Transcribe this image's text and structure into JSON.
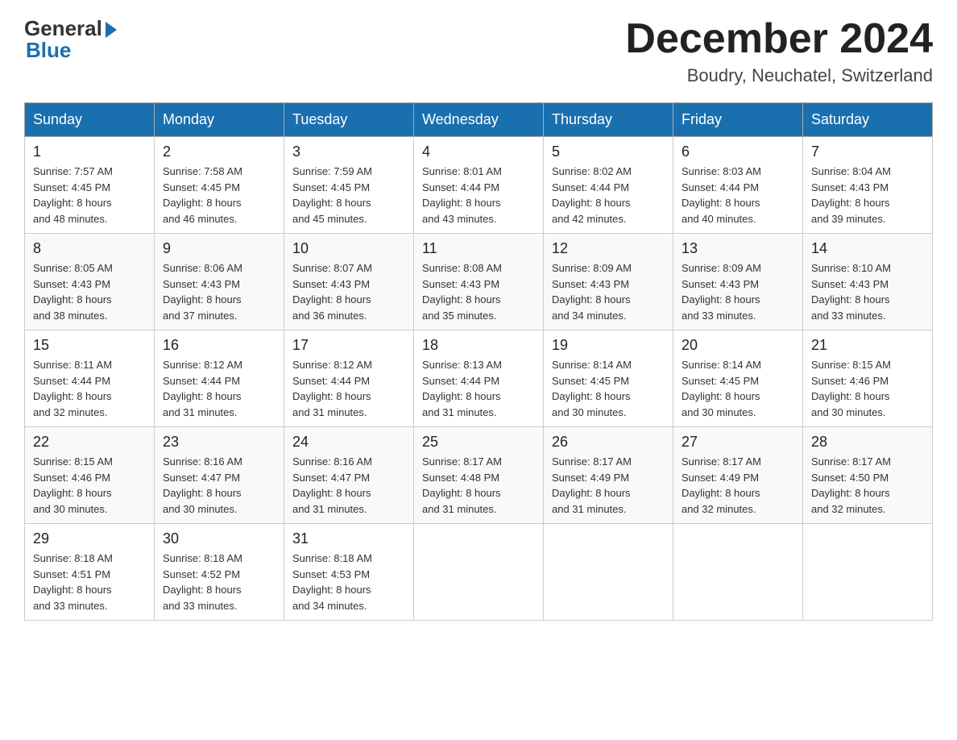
{
  "header": {
    "logo_general": "General",
    "logo_blue": "Blue",
    "month_title": "December 2024",
    "location": "Boudry, Neuchatel, Switzerland"
  },
  "weekdays": [
    "Sunday",
    "Monday",
    "Tuesday",
    "Wednesday",
    "Thursday",
    "Friday",
    "Saturday"
  ],
  "weeks": [
    [
      {
        "day": "1",
        "sunrise": "7:57 AM",
        "sunset": "4:45 PM",
        "daylight": "8 hours and 48 minutes."
      },
      {
        "day": "2",
        "sunrise": "7:58 AM",
        "sunset": "4:45 PM",
        "daylight": "8 hours and 46 minutes."
      },
      {
        "day": "3",
        "sunrise": "7:59 AM",
        "sunset": "4:45 PM",
        "daylight": "8 hours and 45 minutes."
      },
      {
        "day": "4",
        "sunrise": "8:01 AM",
        "sunset": "4:44 PM",
        "daylight": "8 hours and 43 minutes."
      },
      {
        "day": "5",
        "sunrise": "8:02 AM",
        "sunset": "4:44 PM",
        "daylight": "8 hours and 42 minutes."
      },
      {
        "day": "6",
        "sunrise": "8:03 AM",
        "sunset": "4:44 PM",
        "daylight": "8 hours and 40 minutes."
      },
      {
        "day": "7",
        "sunrise": "8:04 AM",
        "sunset": "4:43 PM",
        "daylight": "8 hours and 39 minutes."
      }
    ],
    [
      {
        "day": "8",
        "sunrise": "8:05 AM",
        "sunset": "4:43 PM",
        "daylight": "8 hours and 38 minutes."
      },
      {
        "day": "9",
        "sunrise": "8:06 AM",
        "sunset": "4:43 PM",
        "daylight": "8 hours and 37 minutes."
      },
      {
        "day": "10",
        "sunrise": "8:07 AM",
        "sunset": "4:43 PM",
        "daylight": "8 hours and 36 minutes."
      },
      {
        "day": "11",
        "sunrise": "8:08 AM",
        "sunset": "4:43 PM",
        "daylight": "8 hours and 35 minutes."
      },
      {
        "day": "12",
        "sunrise": "8:09 AM",
        "sunset": "4:43 PM",
        "daylight": "8 hours and 34 minutes."
      },
      {
        "day": "13",
        "sunrise": "8:09 AM",
        "sunset": "4:43 PM",
        "daylight": "8 hours and 33 minutes."
      },
      {
        "day": "14",
        "sunrise": "8:10 AM",
        "sunset": "4:43 PM",
        "daylight": "8 hours and 33 minutes."
      }
    ],
    [
      {
        "day": "15",
        "sunrise": "8:11 AM",
        "sunset": "4:44 PM",
        "daylight": "8 hours and 32 minutes."
      },
      {
        "day": "16",
        "sunrise": "8:12 AM",
        "sunset": "4:44 PM",
        "daylight": "8 hours and 31 minutes."
      },
      {
        "day": "17",
        "sunrise": "8:12 AM",
        "sunset": "4:44 PM",
        "daylight": "8 hours and 31 minutes."
      },
      {
        "day": "18",
        "sunrise": "8:13 AM",
        "sunset": "4:44 PM",
        "daylight": "8 hours and 31 minutes."
      },
      {
        "day": "19",
        "sunrise": "8:14 AM",
        "sunset": "4:45 PM",
        "daylight": "8 hours and 30 minutes."
      },
      {
        "day": "20",
        "sunrise": "8:14 AM",
        "sunset": "4:45 PM",
        "daylight": "8 hours and 30 minutes."
      },
      {
        "day": "21",
        "sunrise": "8:15 AM",
        "sunset": "4:46 PM",
        "daylight": "8 hours and 30 minutes."
      }
    ],
    [
      {
        "day": "22",
        "sunrise": "8:15 AM",
        "sunset": "4:46 PM",
        "daylight": "8 hours and 30 minutes."
      },
      {
        "day": "23",
        "sunrise": "8:16 AM",
        "sunset": "4:47 PM",
        "daylight": "8 hours and 30 minutes."
      },
      {
        "day": "24",
        "sunrise": "8:16 AM",
        "sunset": "4:47 PM",
        "daylight": "8 hours and 31 minutes."
      },
      {
        "day": "25",
        "sunrise": "8:17 AM",
        "sunset": "4:48 PM",
        "daylight": "8 hours and 31 minutes."
      },
      {
        "day": "26",
        "sunrise": "8:17 AM",
        "sunset": "4:49 PM",
        "daylight": "8 hours and 31 minutes."
      },
      {
        "day": "27",
        "sunrise": "8:17 AM",
        "sunset": "4:49 PM",
        "daylight": "8 hours and 32 minutes."
      },
      {
        "day": "28",
        "sunrise": "8:17 AM",
        "sunset": "4:50 PM",
        "daylight": "8 hours and 32 minutes."
      }
    ],
    [
      {
        "day": "29",
        "sunrise": "8:18 AM",
        "sunset": "4:51 PM",
        "daylight": "8 hours and 33 minutes."
      },
      {
        "day": "30",
        "sunrise": "8:18 AM",
        "sunset": "4:52 PM",
        "daylight": "8 hours and 33 minutes."
      },
      {
        "day": "31",
        "sunrise": "8:18 AM",
        "sunset": "4:53 PM",
        "daylight": "8 hours and 34 minutes."
      },
      null,
      null,
      null,
      null
    ]
  ],
  "labels": {
    "sunrise": "Sunrise:",
    "sunset": "Sunset:",
    "daylight": "Daylight:"
  }
}
